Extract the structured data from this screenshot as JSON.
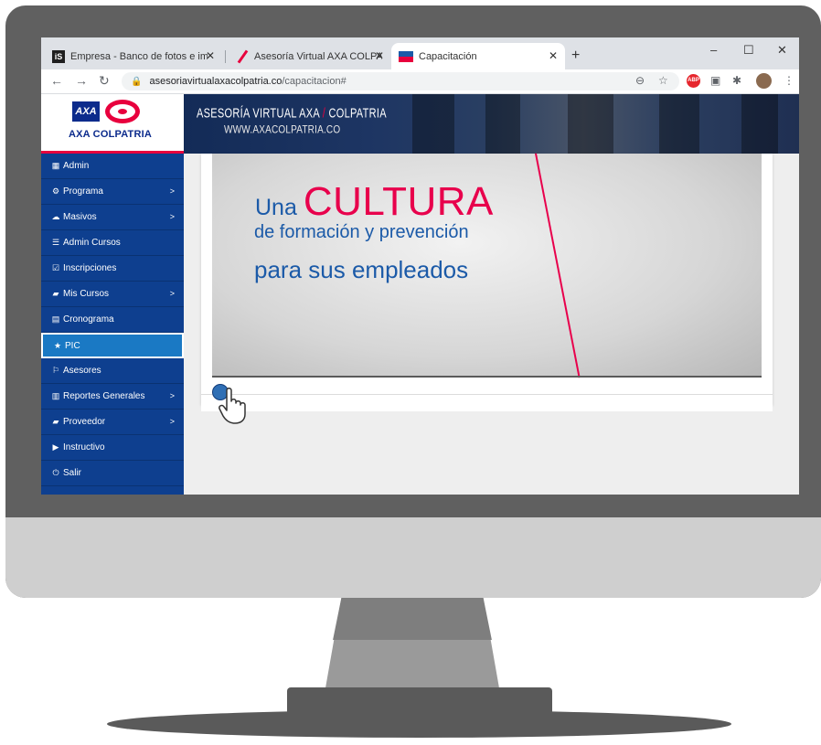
{
  "browser": {
    "tabs": [
      {
        "title": "Empresa - Banco de fotos e imág",
        "icon": "istock-favicon",
        "active": false
      },
      {
        "title": "Asesoría Virtual AXA COLPATRIA",
        "icon": "axa-favicon",
        "active": false
      },
      {
        "title": "Capacitación",
        "icon": "capacitacion-favicon",
        "active": true
      }
    ],
    "new_tab_label": "+",
    "url_host": "asesoriavirtualaxacolpatria.co",
    "url_path": "/capacitacion#",
    "window_controls": {
      "minimize": "–",
      "maximize": "☐",
      "close": "✕"
    },
    "extension_abp": "ABP"
  },
  "header": {
    "logo_axa": "AXA",
    "logo_text": "AXA COLPATRIA",
    "banner_line1_a": "ASESORÍA VIRTUAL AXA",
    "banner_line1_sep": " / ",
    "banner_line1_b": "COLPATRIA",
    "banner_line2": "WWW.AXACOLPATRIA.CO"
  },
  "sidebar": {
    "items": [
      {
        "label": "Admin",
        "icon": "grid-icon",
        "chevron": false
      },
      {
        "label": "Programa",
        "icon": "gear-icon",
        "chevron": true
      },
      {
        "label": "Masivos",
        "icon": "cloud-upload-icon",
        "chevron": true
      },
      {
        "label": "Admin Cursos",
        "icon": "list-icon",
        "chevron": false
      },
      {
        "label": "Inscripciones",
        "icon": "checkbox-icon",
        "chevron": false
      },
      {
        "label": "Mis Cursos",
        "icon": "book-icon",
        "chevron": true
      },
      {
        "label": "Cronograma",
        "icon": "calendar-icon",
        "chevron": false
      },
      {
        "label": "PIC",
        "icon": "star-icon",
        "chevron": false,
        "active": true
      },
      {
        "label": "Asesores",
        "icon": "flag-icon",
        "chevron": false
      },
      {
        "label": "Reportes Generales",
        "icon": "chart-icon",
        "chevron": true
      },
      {
        "label": "Proveedor",
        "icon": "book-icon",
        "chevron": true
      },
      {
        "label": "Instructivo",
        "icon": "play-icon",
        "chevron": false
      },
      {
        "label": "Salir",
        "icon": "power-icon",
        "chevron": false
      }
    ],
    "chevron_symbol": ">"
  },
  "content": {
    "line1_small": "Una",
    "line1_big": "CULTURA",
    "line2": "de formación y prevención",
    "line3": "para sus empleados"
  },
  "colors": {
    "sidebar_bg": "#0e3f8f",
    "active_item": "#1a79c4",
    "brand_red": "#e8004c",
    "brand_blue": "#1b5aa8"
  }
}
